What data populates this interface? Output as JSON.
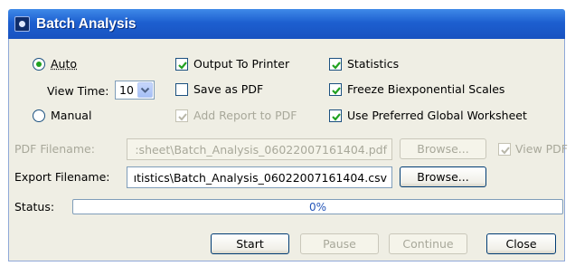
{
  "window": {
    "title": "Batch Analysis",
    "icon": "app-icon"
  },
  "mode": {
    "auto_label": "Auto",
    "manual_label": "Manual",
    "selected": "Auto",
    "view_time_label": "View Time:",
    "view_time_value": "10"
  },
  "options": {
    "output_to_printer": {
      "label": "Output To Printer",
      "checked": true,
      "enabled": true
    },
    "save_as_pdf": {
      "label": "Save as PDF",
      "checked": false,
      "enabled": true
    },
    "add_report_to_pdf": {
      "label": "Add Report to PDF",
      "checked": true,
      "enabled": false
    },
    "statistics": {
      "label": "Statistics",
      "checked": true,
      "enabled": true
    },
    "freeze_biexponential": {
      "label": "Freeze Biexponential Scales",
      "checked": true,
      "enabled": true
    },
    "use_preferred_worksheet": {
      "label": "Use Preferred Global Worksheet",
      "checked": true,
      "enabled": true
    }
  },
  "pdf": {
    "label": "PDF Filename:",
    "value": ":sheet\\Batch_Analysis_06022007161404.pdf",
    "browse_label": "Browse...",
    "view_pdf_label": "View PDF",
    "view_pdf_checked": true,
    "enabled": false
  },
  "export": {
    "label": "Export Filename:",
    "value": "ıtistics\\Batch_Analysis_06022007161404.csv",
    "browse_label": "Browse..."
  },
  "status": {
    "label": "Status:",
    "progress_percent": 0,
    "progress_text": "0%"
  },
  "buttons": {
    "start": "Start",
    "pause": "Pause",
    "continue": "Continue",
    "close": "Close"
  },
  "colors": {
    "titlebar": "#1d5fd0",
    "dialog_bg": "#efeee4",
    "check_green": "#21a121",
    "progress_text": "#2455b8"
  }
}
